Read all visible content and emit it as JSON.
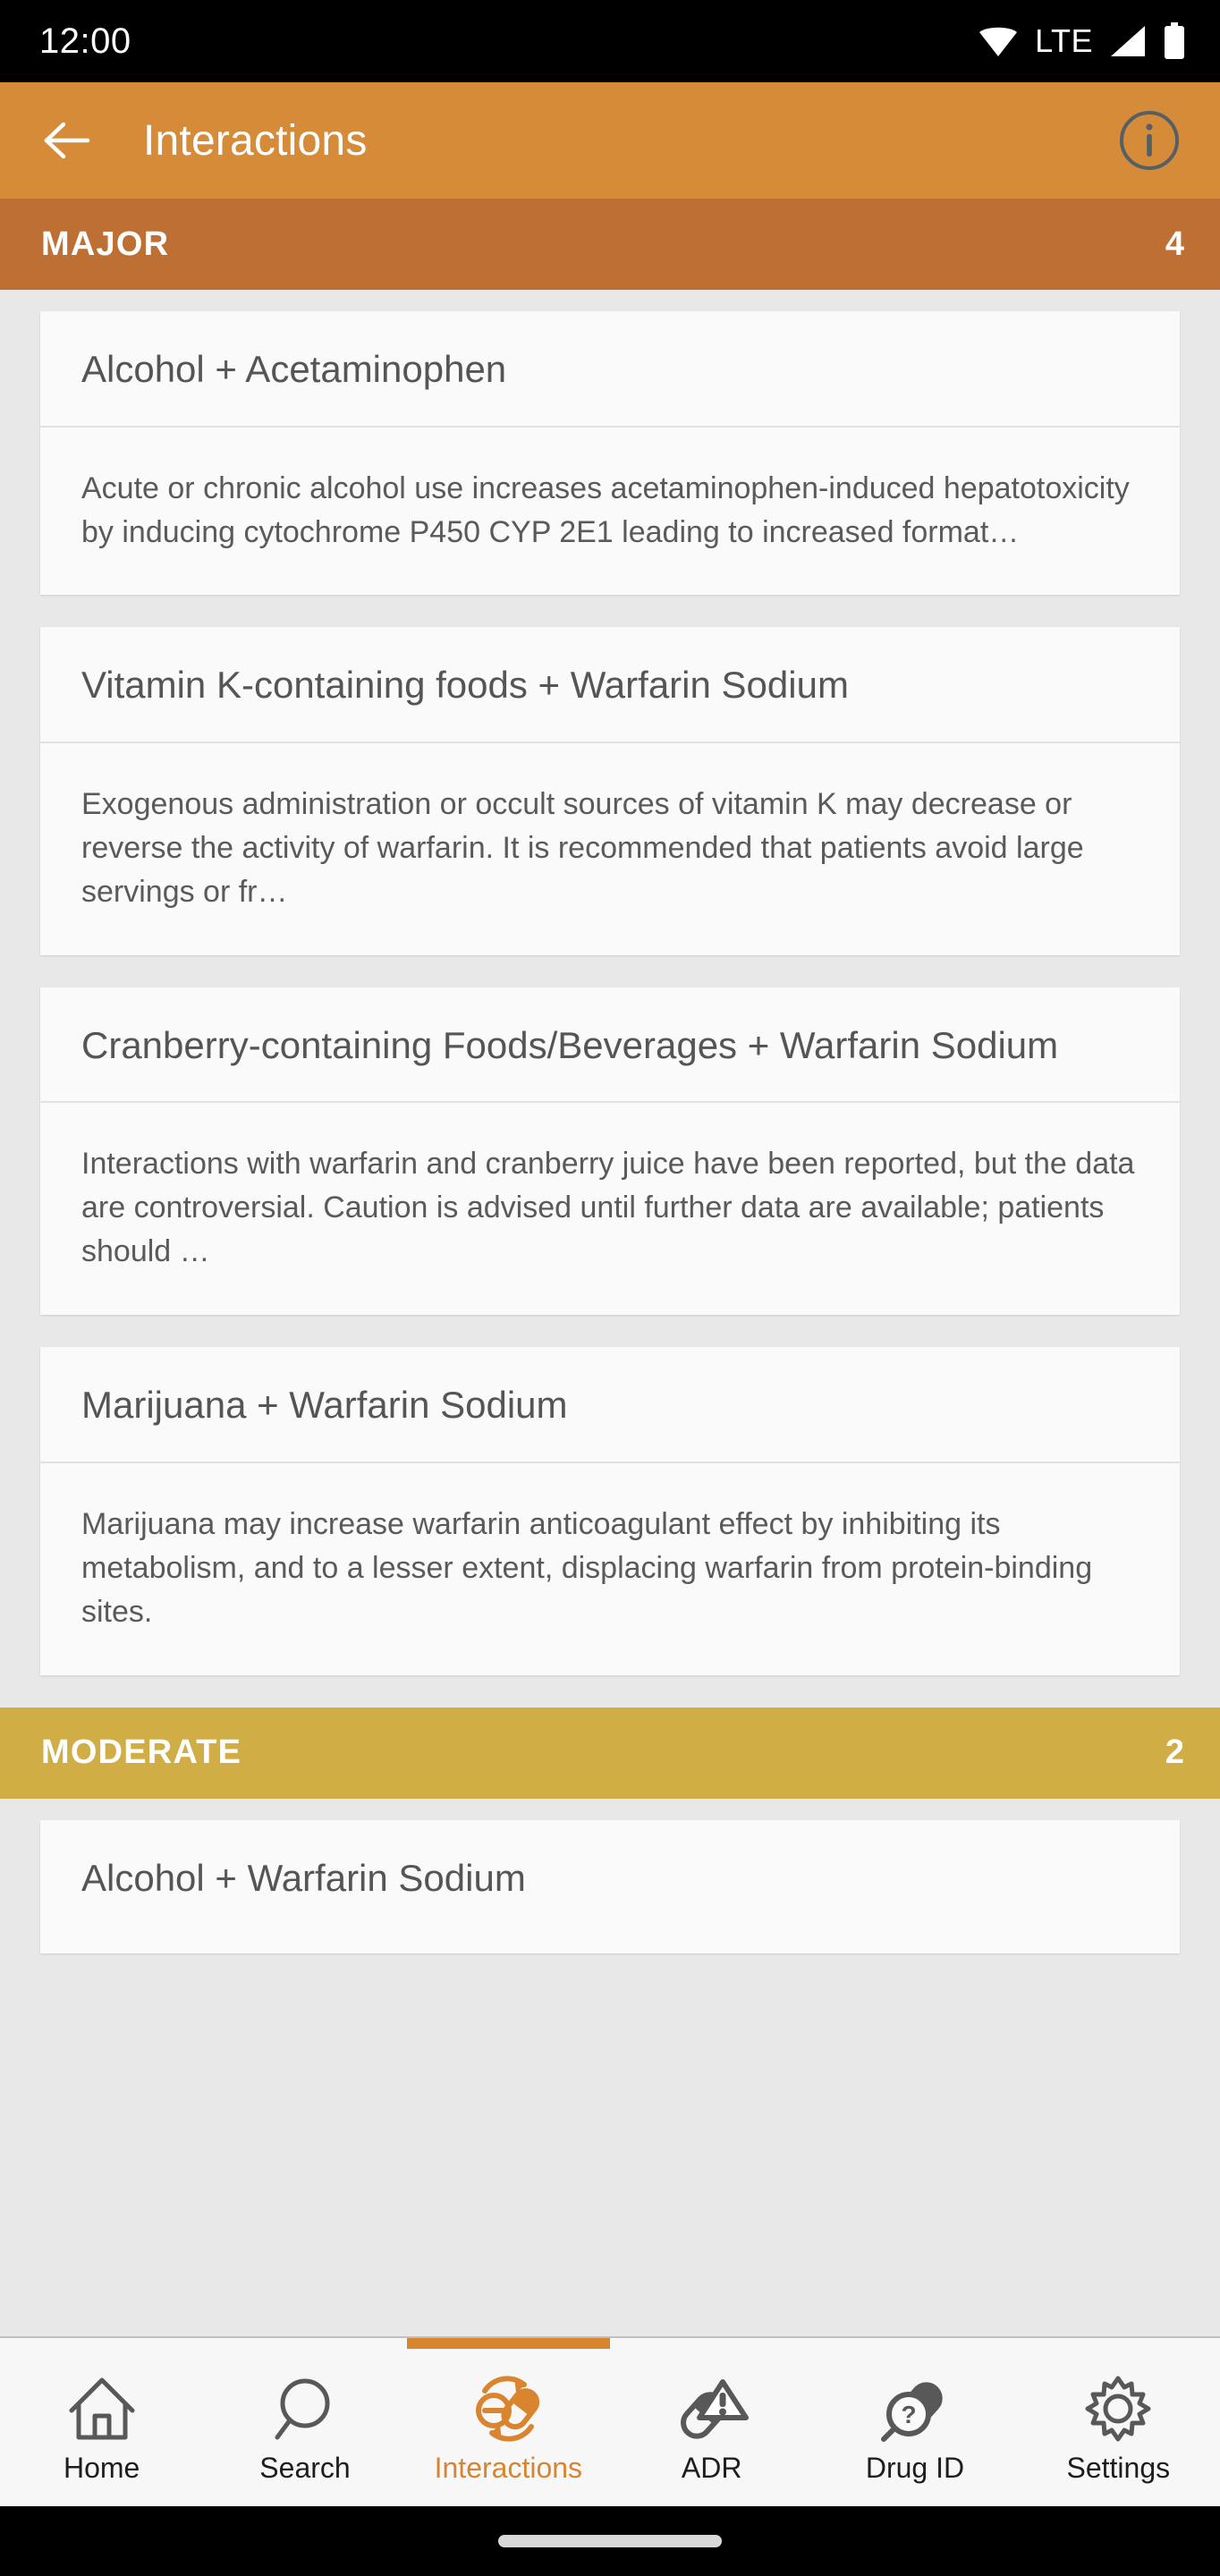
{
  "status_bar": {
    "time": "12:00",
    "network_label": "LTE",
    "icons": [
      "wifi-icon",
      "signal-icon",
      "battery-icon"
    ]
  },
  "app_bar": {
    "back_icon": "arrow-left-icon",
    "title": "Interactions",
    "info_icon": "info-circle-icon",
    "background_color": "#D58B38"
  },
  "sections": [
    {
      "label": "MAJOR",
      "count": "4",
      "color": "#BE7034",
      "items": [
        {
          "title": "Alcohol + Acetaminophen",
          "body": "Acute or chronic alcohol use increases acetaminophen-induced hepatotoxicity by inducing cytochrome P450 CYP 2E1 leading to increased format…"
        },
        {
          "title": "Vitamin K-containing foods + Warfarin Sodium",
          "body": "Exogenous administration or occult sources of vitamin K may decrease or reverse the activity of warfarin. It is recommended that patients avoid large servings or fr…"
        },
        {
          "title": "Cranberry-containing Foods/Beverages + Warfarin Sodium",
          "body": "Interactions with warfarin and cranberry juice have been reported, but the data are controversial. Caution is advised until further data are available; patients should …"
        },
        {
          "title": "Marijuana + Warfarin Sodium",
          "body": "Marijuana may increase warfarin anticoagulant effect by inhibiting its metabolism, and to a lesser extent, displacing warfarin from protein-binding sites."
        }
      ]
    },
    {
      "label": "MODERATE",
      "count": "2",
      "color": "#D0AD45",
      "items": [
        {
          "title": "Alcohol + Warfarin Sodium",
          "body": ""
        }
      ]
    }
  ],
  "bottom_nav": {
    "active_color": "#D98530",
    "items": [
      {
        "label": "Home",
        "icon": "home-icon",
        "active": false
      },
      {
        "label": "Search",
        "icon": "search-icon",
        "active": false
      },
      {
        "label": "Interactions",
        "icon": "interactions-icon",
        "active": true
      },
      {
        "label": "ADR",
        "icon": "adr-warning-icon",
        "active": false
      },
      {
        "label": "Drug ID",
        "icon": "drug-id-icon",
        "active": false
      },
      {
        "label": "Settings",
        "icon": "gear-icon",
        "active": false
      }
    ]
  }
}
